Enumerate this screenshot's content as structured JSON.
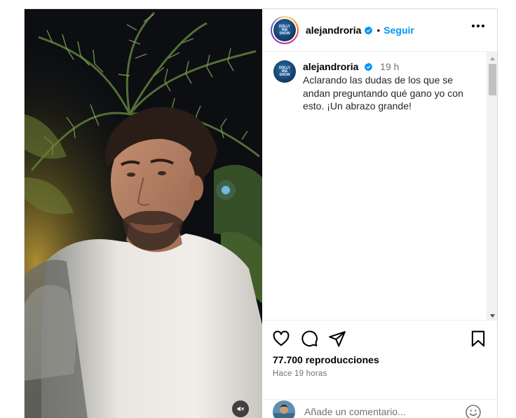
{
  "post": {
    "username": "alejandroria",
    "follow_label": "Seguir",
    "dot": "•",
    "caption": {
      "username": "alejandroria",
      "time": "19 h",
      "text": "Aclarando las dudas de los que se andan preguntando qué gano yo con esto. ¡Un abrazo grande!"
    },
    "views": "77.700 reproducciones",
    "time_ago": "Hace 19 horas",
    "comment_placeholder": "Añade un comentario..."
  },
  "avatar_logo_lines": [
    "DOLLY",
    "RIA",
    "SHOW"
  ],
  "colors": {
    "follow_blue": "#0095f6",
    "verified_blue": "#0095f6",
    "secondary_text": "#737373",
    "border": "#dbdbdb"
  },
  "icons": {
    "verified": "verified-badge-icon",
    "more": "more-options-icon",
    "like": "heart-icon",
    "comment": "comment-bubble-icon",
    "share": "paper-plane-icon",
    "save": "bookmark-icon",
    "mute": "speaker-muted-icon",
    "emoji": "emoji-smiley-icon",
    "scroll_up": "scroll-up-arrow-icon",
    "scroll_down": "scroll-down-arrow-icon"
  }
}
